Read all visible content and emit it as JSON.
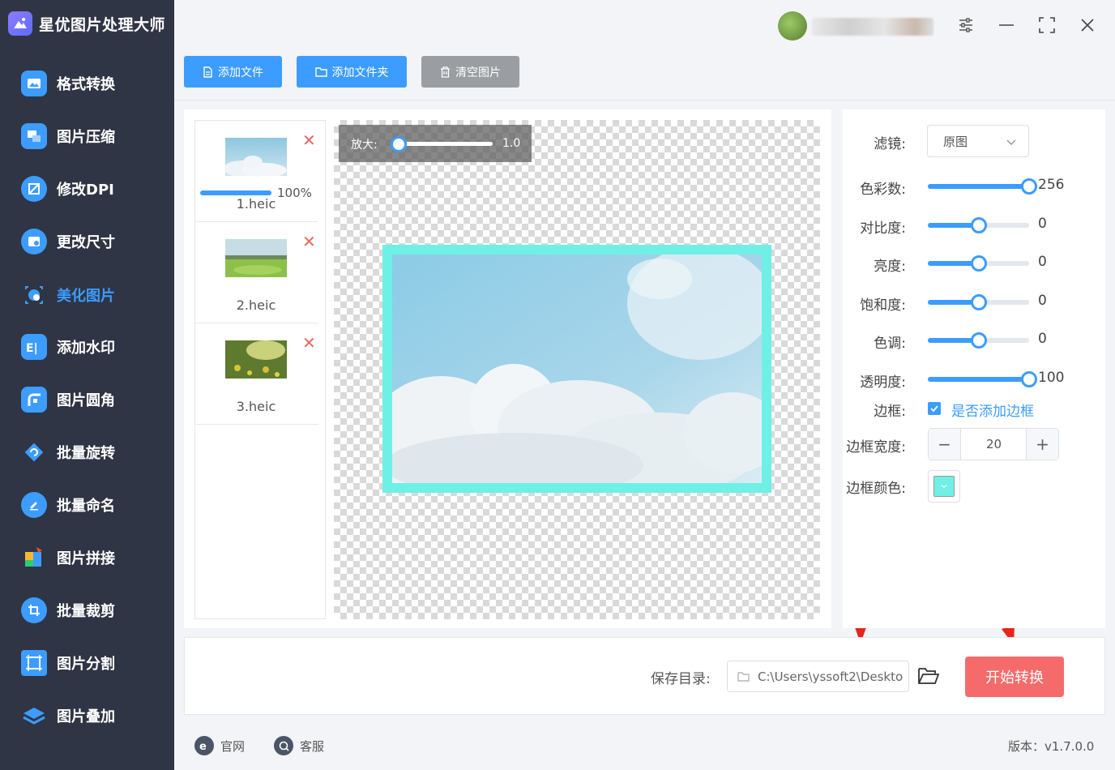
{
  "app": {
    "title": "星优图片处理大师"
  },
  "sidebar": {
    "items": [
      {
        "label": "格式转换",
        "icon": "image-convert-icon",
        "active": false
      },
      {
        "label": "图片压缩",
        "icon": "compress-icon",
        "active": false
      },
      {
        "label": "修改DPI",
        "icon": "dpi-icon",
        "active": false
      },
      {
        "label": "更改尺寸",
        "icon": "resize-icon",
        "active": false
      },
      {
        "label": "美化图片",
        "icon": "beautify-icon",
        "active": true
      },
      {
        "label": "添加水印",
        "icon": "watermark-icon",
        "active": false
      },
      {
        "label": "图片圆角",
        "icon": "rounded-corner-icon",
        "active": false
      },
      {
        "label": "批量旋转",
        "icon": "rotate-icon",
        "active": false
      },
      {
        "label": "批量命名",
        "icon": "rename-icon",
        "active": false
      },
      {
        "label": "图片拼接",
        "icon": "puzzle-icon",
        "active": false
      },
      {
        "label": "批量裁剪",
        "icon": "crop-icon",
        "active": false
      },
      {
        "label": "图片分割",
        "icon": "split-icon",
        "active": false
      },
      {
        "label": "图片叠加",
        "icon": "layers-icon",
        "active": false
      }
    ]
  },
  "toolbar": {
    "add_file": "添加文件",
    "add_folder": "添加文件夹",
    "clear": "清空图片"
  },
  "files": [
    {
      "name": "1.heic",
      "progress": 100,
      "progress_text": "100%"
    },
    {
      "name": "2.heic"
    },
    {
      "name": "3.heic"
    }
  ],
  "preview": {
    "zoom_label": "放大:",
    "zoom_value": "1.0",
    "zoom_fraction": 0.0
  },
  "settings": {
    "filter_label": "滤镜:",
    "filter_value": "原图",
    "sliders": [
      {
        "label": "色彩数:",
        "value": "256",
        "fraction": 1.0
      },
      {
        "label": "对比度:",
        "value": "0",
        "fraction": 0.5
      },
      {
        "label": "亮度:",
        "value": "0",
        "fraction": 0.5
      },
      {
        "label": "饱和度:",
        "value": "0",
        "fraction": 0.5
      },
      {
        "label": "色调:",
        "value": "0",
        "fraction": 0.5
      },
      {
        "label": "透明度:",
        "value": "100",
        "fraction": 1.0
      }
    ],
    "border_label": "边框:",
    "border_checkbox_label": "是否添加边框",
    "border_checked": true,
    "border_width_label": "边框宽度:",
    "border_width_value": "20",
    "border_color_label": "边框颜色:",
    "border_color": "#6ff0e6"
  },
  "save": {
    "label": "保存目录:",
    "path": "C:\\Users\\yssoft2\\Deskto",
    "start_button": "开始转换"
  },
  "footer": {
    "website": "官网",
    "support": "客服",
    "version": "版本：v1.7.0.0"
  },
  "colors": {
    "accent": "#3c9cff",
    "sidebar_bg": "#2f3544",
    "start_button": "#f56b6b",
    "arrow": "#e8251b"
  }
}
